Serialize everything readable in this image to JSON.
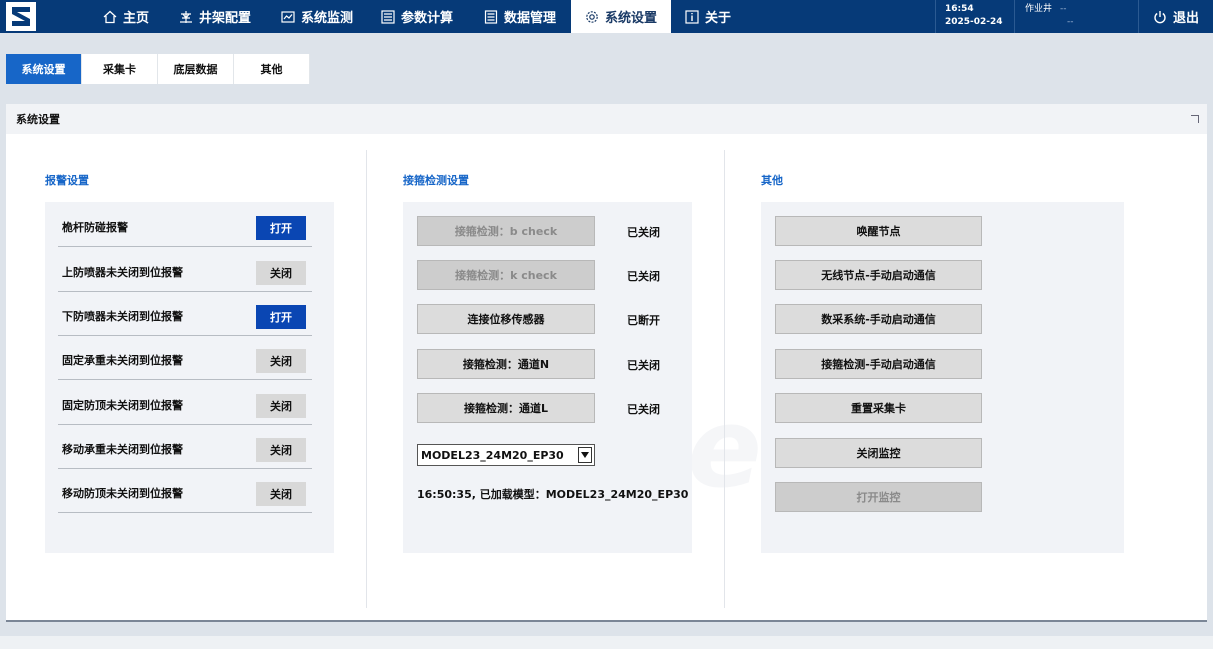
{
  "nav": {
    "items": [
      {
        "label": "主页",
        "icon": "home-icon"
      },
      {
        "label": "井架配置",
        "icon": "derrick-icon"
      },
      {
        "label": "系统监测",
        "icon": "monitor-icon"
      },
      {
        "label": "参数计算",
        "icon": "calculator-icon"
      },
      {
        "label": "数据管理",
        "icon": "data-icon"
      },
      {
        "label": "系统设置",
        "icon": "gear-icon",
        "active": true
      },
      {
        "label": "关于",
        "icon": "info-icon"
      }
    ],
    "time": "16:54",
    "date": "2025-02-24",
    "well_label": "作业井",
    "well_value": "--",
    "well_value2": "--",
    "logout": "退出"
  },
  "subtabs": [
    "系统设置",
    "采集卡",
    "底层数据",
    "其他"
  ],
  "panel": {
    "title": "系统设置",
    "watermark": "sinie"
  },
  "alarm": {
    "title": "报警设置",
    "rows": [
      {
        "label": "桅杆防碰报警",
        "state": "打开",
        "on": true
      },
      {
        "label": "上防喷器未关闭到位报警",
        "state": "关闭",
        "on": false
      },
      {
        "label": "下防喷器未关闭到位报警",
        "state": "打开",
        "on": true
      },
      {
        "label": "固定承重未关闭到位报警",
        "state": "关闭",
        "on": false
      },
      {
        "label": "固定防顶未关闭到位报警",
        "state": "关闭",
        "on": false
      },
      {
        "label": "移动承重未关闭到位报警",
        "state": "关闭",
        "on": false
      },
      {
        "label": "移动防顶未关闭到位报警",
        "state": "关闭",
        "on": false
      }
    ]
  },
  "detect": {
    "title": "接箍检测设置",
    "rows": [
      {
        "label": "接箍检测：b check",
        "status": "已关闭",
        "disabled": true
      },
      {
        "label": "接箍检测：k check",
        "status": "已关闭",
        "disabled": true
      },
      {
        "label": "连接位移传感器",
        "status": "已断开",
        "disabled": false
      },
      {
        "label": "接箍检测：通道N",
        "status": "已关闭",
        "disabled": false
      },
      {
        "label": "接箍检测：通道L",
        "status": "已关闭",
        "disabled": false
      }
    ],
    "model_select": "MODEL23_24M20_EP30",
    "loaded_text": "16:50:35, 已加载模型：MODEL23_24M20_EP30"
  },
  "other": {
    "title": "其他",
    "buttons": [
      {
        "label": "唤醒节点",
        "disabled": false
      },
      {
        "label": "无线节点-手动启动通信",
        "disabled": false
      },
      {
        "label": "数采系统-手动启动通信",
        "disabled": false
      },
      {
        "label": "接箍检测-手动启动通信",
        "disabled": false
      },
      {
        "label": "重置采集卡",
        "disabled": false
      },
      {
        "label": "关闭监控",
        "disabled": false
      },
      {
        "label": "打开监控",
        "disabled": true
      }
    ]
  }
}
